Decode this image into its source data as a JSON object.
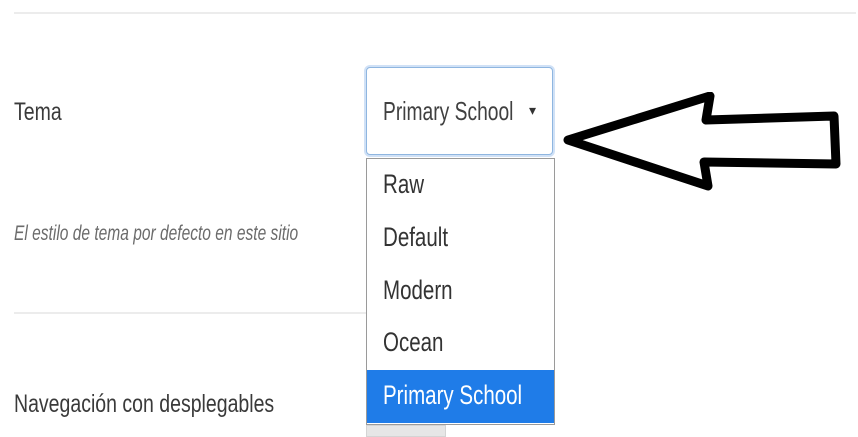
{
  "settings": {
    "theme": {
      "label": "Tema",
      "hint": "El estilo de tema por defecto en este sitio",
      "selected": "Primary School",
      "caret": "▾",
      "options": [
        "Raw",
        "Default",
        "Modern",
        "Ocean",
        "Primary School"
      ]
    },
    "navigation": {
      "label": "Navegación con desplegables"
    }
  },
  "annotation": {
    "arrow_color": "#000000"
  },
  "colors": {
    "highlight": "#1f7ce8",
    "focus_border": "#8fb6e0"
  }
}
